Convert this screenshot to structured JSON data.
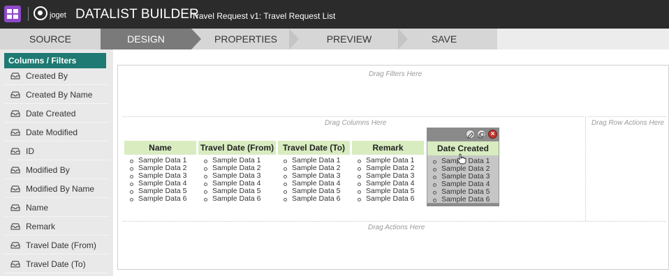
{
  "header": {
    "logo_text": "joget",
    "title": "DATALIST BUILDER",
    "subtitle": "Travel Request v1: Travel Request List"
  },
  "tabs": [
    {
      "label": "SOURCE",
      "active": false
    },
    {
      "label": "DESIGN",
      "active": true
    },
    {
      "label": "PROPERTIES",
      "active": false
    },
    {
      "label": "PREVIEW",
      "active": false
    },
    {
      "label": "SAVE",
      "active": false
    }
  ],
  "sidebar": {
    "header": "Columns / Filters",
    "items": [
      {
        "label": "Created By",
        "icon": "inbox-tray-icon"
      },
      {
        "label": "Created By Name",
        "icon": "inbox-tray-icon"
      },
      {
        "label": "Date Created",
        "icon": "inbox-tray-icon"
      },
      {
        "label": "Date Modified",
        "icon": "inbox-tray-icon"
      },
      {
        "label": "ID",
        "icon": "inbox-tray-icon"
      },
      {
        "label": "Modified By",
        "icon": "inbox-tray-icon"
      },
      {
        "label": "Modified By Name",
        "icon": "inbox-tray-icon"
      },
      {
        "label": "Name",
        "icon": "inbox-tray-icon"
      },
      {
        "label": "Remark",
        "icon": "inbox-tray-icon"
      },
      {
        "label": "Travel Date (From)",
        "icon": "inbox-tray-icon"
      },
      {
        "label": "Travel Date (To)",
        "icon": "inbox-tray-icon"
      }
    ]
  },
  "canvas": {
    "filters_hint": "Drag Filters Here",
    "columns_hint": "Drag Columns Here",
    "row_actions_hint": "Drag Row Actions Here",
    "actions_hint": "Drag Actions Here",
    "columns": [
      {
        "title": "Name",
        "rows": [
          "Sample Data 1",
          "Sample Data 2",
          "Sample Data 3",
          "Sample Data 4",
          "Sample Data 5",
          "Sample Data 6"
        ]
      },
      {
        "title": "Travel Date (From)",
        "rows": [
          "Sample Data 1",
          "Sample Data 2",
          "Sample Data 3",
          "Sample Data 4",
          "Sample Data 5",
          "Sample Data 6"
        ]
      },
      {
        "title": "Travel Date (To)",
        "rows": [
          "Sample Data 1",
          "Sample Data 2",
          "Sample Data 3",
          "Sample Data 4",
          "Sample Data 5",
          "Sample Data 6"
        ]
      },
      {
        "title": "Remark",
        "rows": [
          "Sample Data 1",
          "Sample Data 2",
          "Sample Data 3",
          "Sample Data 4",
          "Sample Data 5",
          "Sample Data 6"
        ]
      },
      {
        "title": "Date Created",
        "rows": [
          "Sample Data 1",
          "Sample Data 2",
          "Sample Data 3",
          "Sample Data 4",
          "Sample Data 5",
          "Sample Data 6"
        ],
        "selected": true
      }
    ],
    "selected_column_actions": [
      "edit-icon",
      "copy-icon",
      "delete-icon"
    ],
    "delete_glyph": "×"
  },
  "colors": {
    "topbar": "#2b2b2b",
    "app_icon": "#8e49c8",
    "active_tab": "#7a7a7a",
    "sidebar_header": "#1e7a72",
    "column_header": "#d8ecc0",
    "delete_button": "#c0362c"
  }
}
